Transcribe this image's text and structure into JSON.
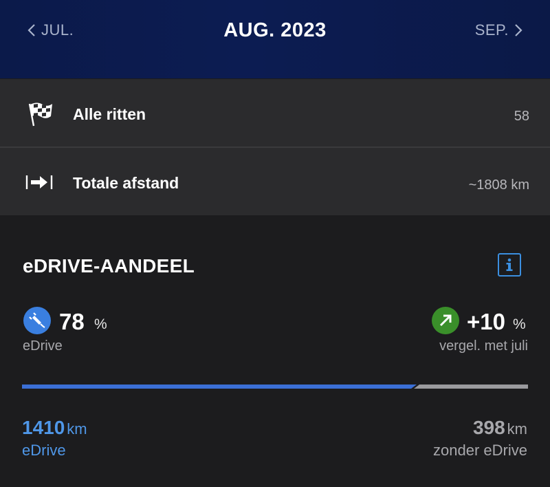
{
  "header": {
    "prev_label": "JUL.",
    "title": "AUG. 2023",
    "next_label": "SEP."
  },
  "stats": [
    {
      "icon": "checkered-flag-icon",
      "label": "Alle ritten",
      "value": "58"
    },
    {
      "icon": "distance-arrow-icon",
      "label": "Totale afstand",
      "value": "~1808 km"
    }
  ],
  "edrive": {
    "title": "eDRIVE-AANDEEL",
    "share_value": "78",
    "share_unit": "%",
    "share_label": "eDrive",
    "change_value": "+10",
    "change_unit": "%",
    "change_label": "vergel. met juli",
    "progress_fraction": 0.78,
    "edrive_km": "1410",
    "edrive_km_unit": "km",
    "edrive_km_label": "eDrive",
    "other_km": "398",
    "other_km_unit": "km",
    "other_km_label": "zonder eDrive"
  },
  "colors": {
    "accent_blue": "#3b6fd6",
    "text_blue": "#4f97e8",
    "positive_green": "#3a8f2a",
    "bar_remaining": "#9a9a9e"
  }
}
